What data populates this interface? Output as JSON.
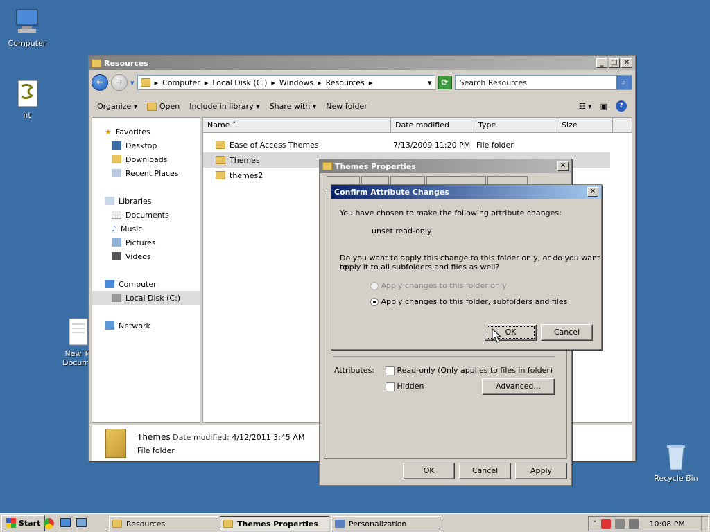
{
  "desktop": {
    "icons": [
      {
        "label": "Computer"
      },
      {
        "label": "nt"
      },
      {
        "label": "New Te\nDocume"
      },
      {
        "label": "Recycle Bin"
      }
    ]
  },
  "explorer": {
    "title": "Resources",
    "breadcrumb": [
      "Computer",
      "Local Disk (C:)",
      "Windows",
      "Resources"
    ],
    "search_placeholder": "Search Resources",
    "toolbar": {
      "organize": "Organize",
      "open": "Open",
      "include": "Include in library",
      "share": "Share with",
      "new_folder": "New folder"
    },
    "nav": {
      "favorites": "Favorites",
      "desktop": "Desktop",
      "downloads": "Downloads",
      "recent": "Recent Places",
      "libraries": "Libraries",
      "documents": "Documents",
      "music": "Music",
      "pictures": "Pictures",
      "videos": "Videos",
      "computer": "Computer",
      "local_disk": "Local Disk (C:)",
      "network": "Network"
    },
    "columns": {
      "name": "Name",
      "date": "Date modified",
      "type": "Type",
      "size": "Size"
    },
    "files": [
      {
        "name": "Ease of Access Themes",
        "date": "7/13/2009 11:20 PM",
        "type": "File folder"
      },
      {
        "name": "Themes",
        "date": "",
        "type": ""
      },
      {
        "name": "themes2",
        "date": "",
        "type": ""
      }
    ],
    "details": {
      "name": "Themes",
      "date_label": "Date modified:",
      "date_value": "4/12/2011 3:45 AM",
      "type": "File folder"
    }
  },
  "props": {
    "title": "Themes Properties",
    "attributes_label": "Attributes:",
    "readonly_label": "Read-only (Only applies to files in folder)",
    "hidden_label": "Hidden",
    "advanced": "Advanced...",
    "ok": "OK",
    "cancel": "Cancel",
    "apply": "Apply"
  },
  "confirm": {
    "title": "Confirm Attribute Changes",
    "line1": "You have chosen to make the following attribute changes:",
    "change": "unset read-only",
    "question1": "Do you want to apply this change to this folder only, or do you want to",
    "question2": "apply it to all subfolders and files as well?",
    "option1": "Apply changes to this folder only",
    "option2": "Apply changes to this folder, subfolders and files",
    "ok": "OK",
    "cancel": "Cancel"
  },
  "taskbar": {
    "start": "Start",
    "tasks": [
      "Resources",
      "Themes Properties",
      "Personalization"
    ],
    "clock": "10:08 PM"
  }
}
